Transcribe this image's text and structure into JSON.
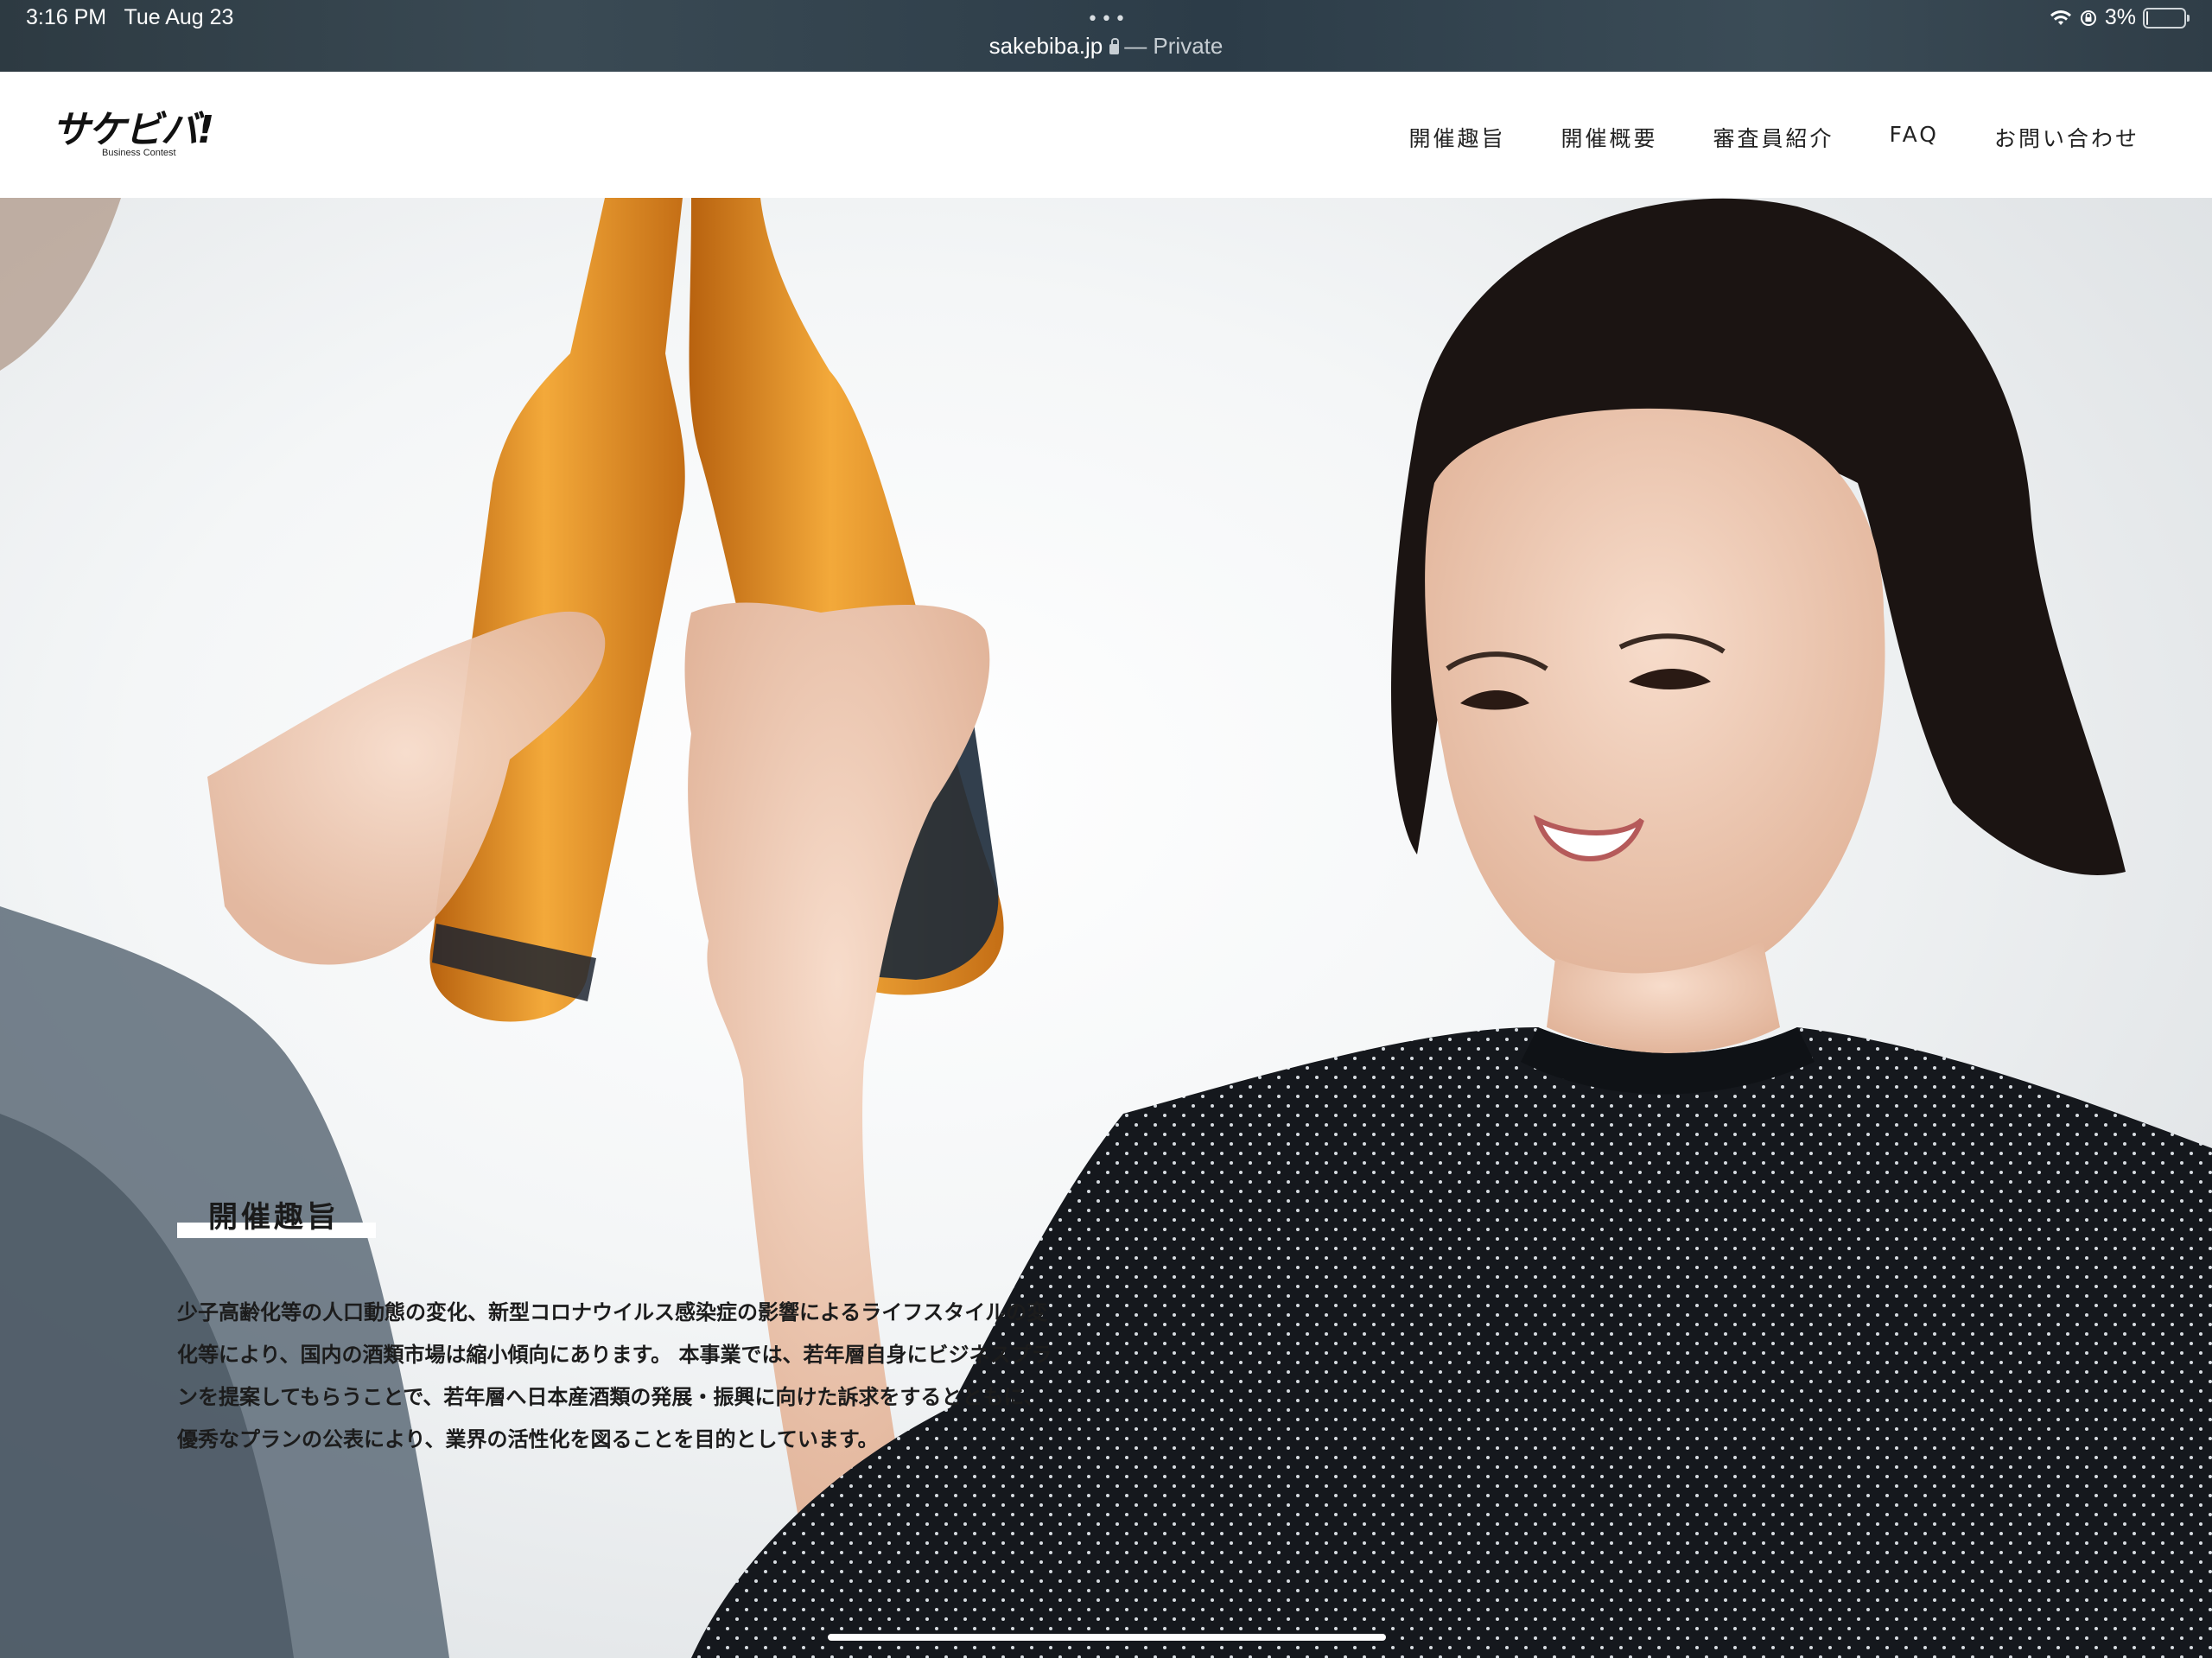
{
  "status_bar": {
    "time": "3:16 PM",
    "date": "Tue Aug 23",
    "url": "sakebiba.jp",
    "private_label": "— Private",
    "battery": "3%",
    "battery_level": 0.03,
    "icons": [
      "wifi-icon",
      "lock-rotation-icon",
      "battery-icon",
      "lock-icon",
      "more-dots-icon"
    ]
  },
  "header": {
    "logo_text": "サケビバ!",
    "logo_subtext": "Business Contest",
    "nav": [
      {
        "label": "開催趣旨"
      },
      {
        "label": "開催概要"
      },
      {
        "label": "審査員紹介"
      },
      {
        "label": "FAQ"
      },
      {
        "label": "お問い合わせ"
      }
    ]
  },
  "hero": {
    "image_alt": "",
    "section_title": "開催趣旨",
    "section_text": "少子高齢化等の人口動態の変化、新型コロナウイルス感染症の影響によるライフスタイルの変化等により、国内の酒類市場は縮小傾向にあります。 本事業では、若年層自身にビジネスプランを提案してもらうことで、若年層へ日本産酒類の発展・振興に向けた訴求をするとともに、 優秀なプランの公表により、業界の活性化を図ることを目的としています。"
  },
  "colors": {
    "status_bar": "#34444e",
    "header_bg": "#ffffff",
    "text": "#1c1c1c",
    "bottle": "#e39a2a"
  }
}
